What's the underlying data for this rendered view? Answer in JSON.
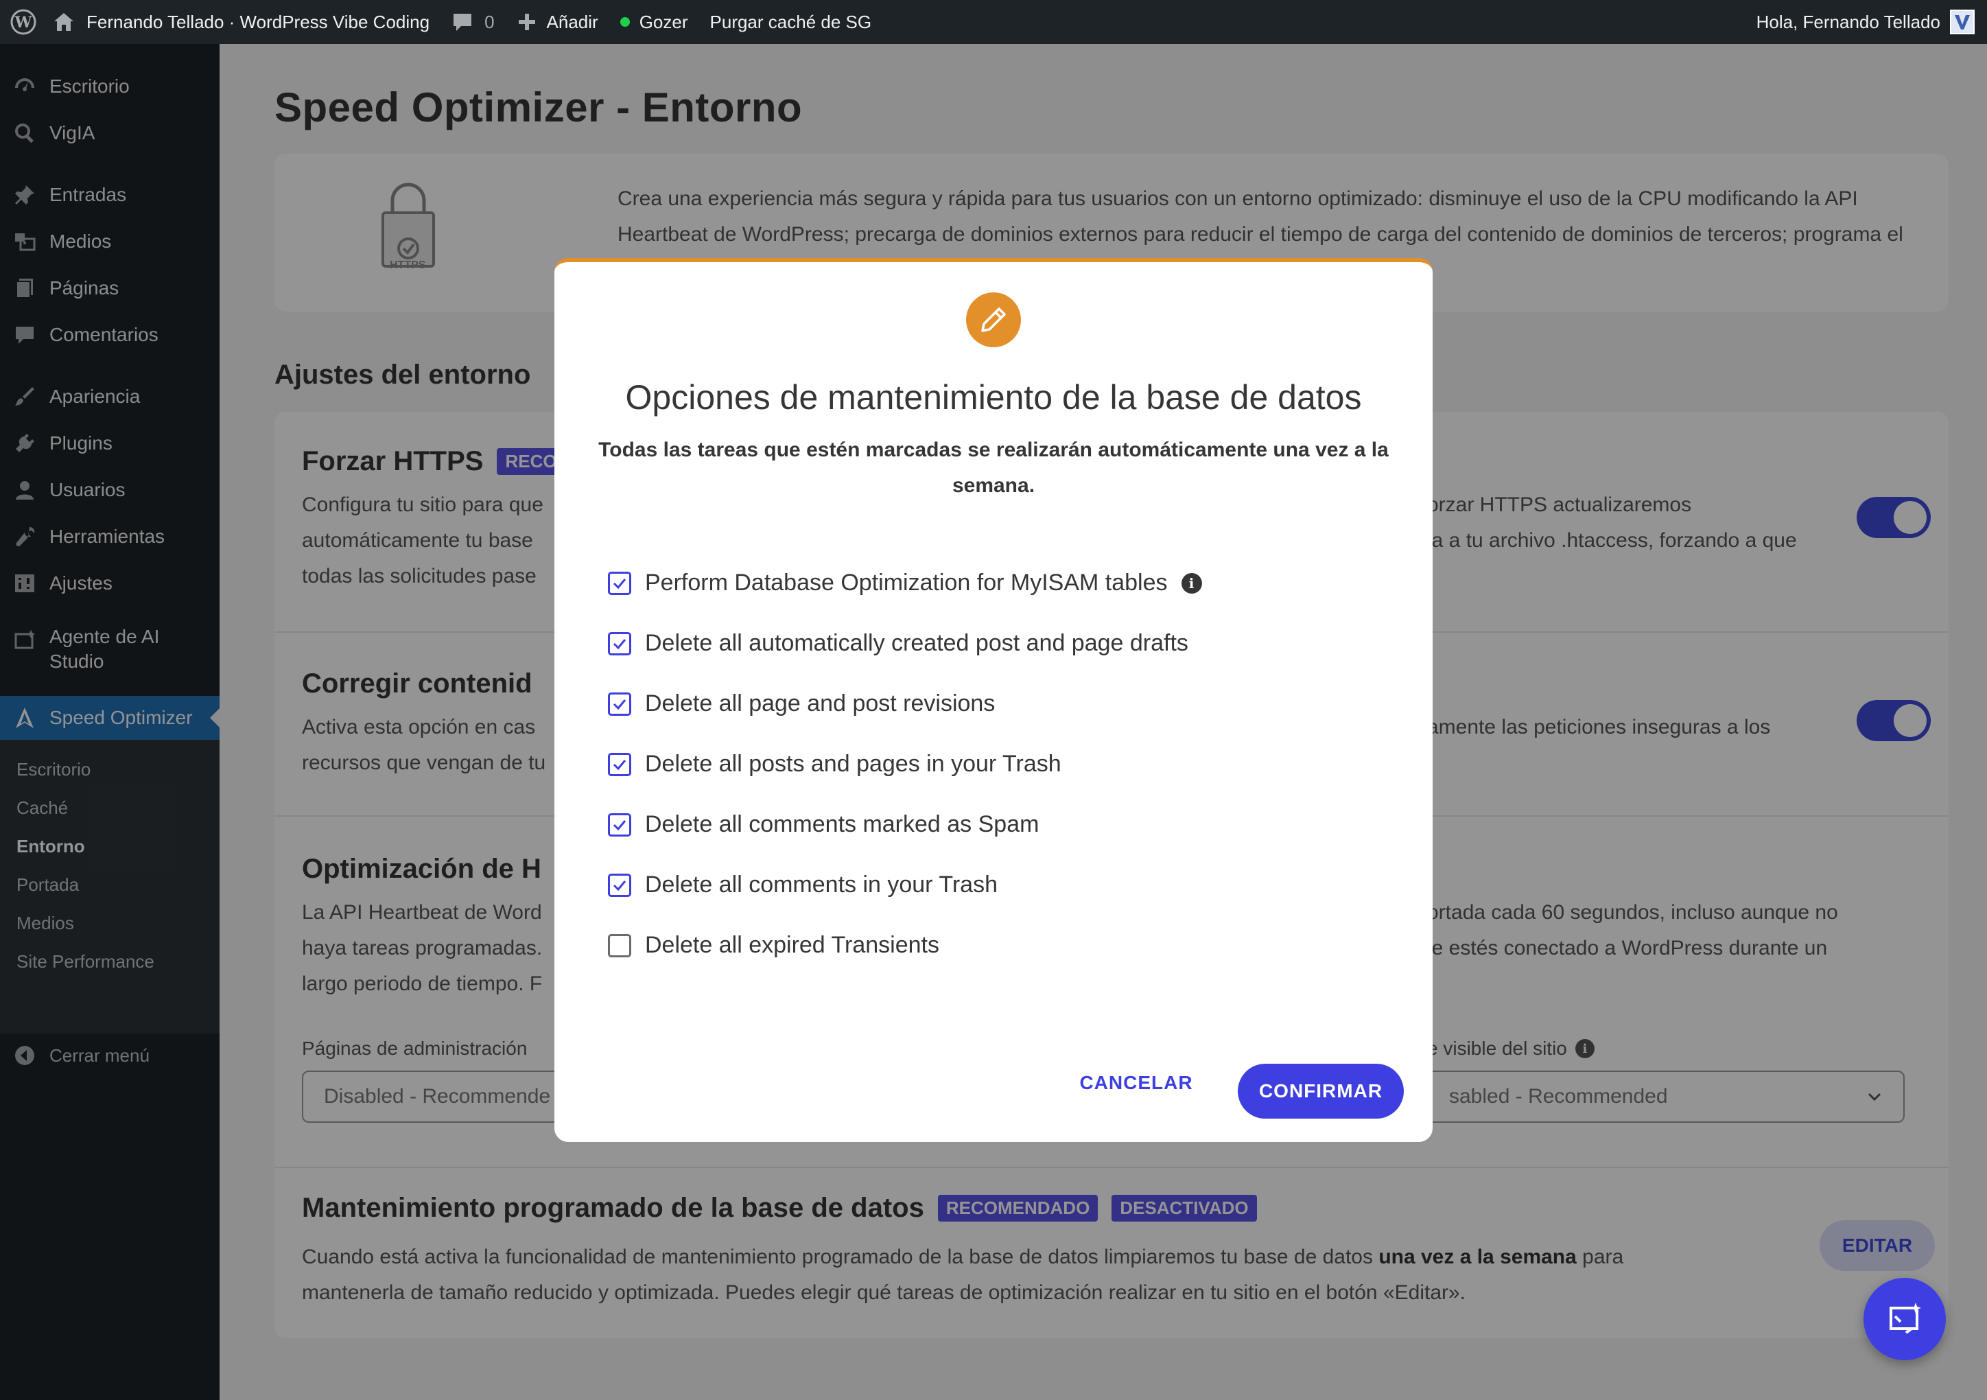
{
  "adminbar": {
    "site_name": "Fernando Tellado · WordPress Vibe Coding",
    "comments_count": "0",
    "add_label": "Añadir",
    "gozer_label": "Gozer",
    "purge_label": "Purgar caché de SG",
    "greeting": "Hola, Fernando Tellado"
  },
  "sidebar": {
    "items": [
      {
        "label": "Escritorio",
        "icon": "dashboard-icon"
      },
      {
        "label": "VigIA",
        "icon": "search-icon"
      },
      {
        "label": "Entradas",
        "icon": "pin-icon"
      },
      {
        "label": "Medios",
        "icon": "media-icon"
      },
      {
        "label": "Páginas",
        "icon": "pages-icon"
      },
      {
        "label": "Comentarios",
        "icon": "comment-icon"
      },
      {
        "label": "Apariencia",
        "icon": "brush-icon"
      },
      {
        "label": "Plugins",
        "icon": "plugin-icon"
      },
      {
        "label": "Usuarios",
        "icon": "user-icon"
      },
      {
        "label": "Herramientas",
        "icon": "wrench-icon"
      },
      {
        "label": "Ajustes",
        "icon": "settings-icon"
      },
      {
        "label": "Agente de AI Studio",
        "icon": "ai-agent-icon"
      },
      {
        "label": "Speed Optimizer",
        "icon": "speed-optimizer-icon"
      }
    ],
    "agent_label_1": "Agente de AI",
    "agent_label_2": "Studio",
    "submenu": [
      "Escritorio",
      "Caché",
      "Entorno",
      "Portada",
      "Medios",
      "Site Performance"
    ],
    "collapse_label": "Cerrar menú"
  },
  "page": {
    "title": "Speed Optimizer - Entorno",
    "https_icon_text": "HTTPS",
    "intro_line1": "Crea una experiencia más segura y rápida para tus usuarios con un entorno optimizado: disminuye el uso de la CPU modificando la API",
    "intro_line2": "Heartbeat de WordPress; precarga de dominios externos para reducir el tiempo de carga del contenido de dominios de terceros; programa el",
    "section_heading": "Ajustes del entorno",
    "https": {
      "title": "Forzar HTTPS",
      "badge": "RECO",
      "left_lines": [
        "Configura tu sitio para que",
        "automáticamente tu base",
        "todas las solicitudes pase"
      ],
      "right_lines": [
        "orzar HTTPS actualizaremos",
        "la a tu archivo .htaccess, forzando a que"
      ]
    },
    "mixed": {
      "title": "Corregir contenid",
      "left_lines": [
        "Activa esta opción en cas",
        "recursos que vengan de tu"
      ],
      "right_line": "amente las peticiones inseguras a los"
    },
    "heartbeat": {
      "title": "Optimización de H",
      "left_lines": [
        "La API Heartbeat de Word",
        "haya tareas programadas.",
        "largo periodo de tiempo. F"
      ],
      "right_lines": [
        "ortada cada 60 segundos, incluso aunque no",
        "ie estés conectado a WordPress durante un"
      ],
      "admin_label": "Páginas de administración",
      "admin_value": "Disabled - Recommende",
      "visible_label": "e visible del sitio",
      "visible_value": "sabled - Recommended"
    },
    "db": {
      "title": "Mantenimiento programado de la base de datos",
      "badge_recommended": "RECOMENDADO",
      "badge_disabled": "DESACTIVADO",
      "line1_a": "Cuando está activa la funcionalidad de mantenimiento programado de la base de datos limpiaremos tu base de datos ",
      "line1_b": "una vez a la semana",
      "line1_c": " para",
      "line2": "mantenerla de tamaño reducido y optimizada. Puedes elegir qué tareas de optimización realizar en tu sitio en el botón «Editar».",
      "edit_label": "EDITAR"
    }
  },
  "modal": {
    "title": "Opciones de mantenimiento de la base de datos",
    "subtitle": "Todas las tareas que estén marcadas se realizarán automáticamente una vez a la semana.",
    "options": [
      {
        "label": "Perform Database Optimization for MyISAM tables",
        "checked": true
      },
      {
        "label": "Delete all automatically created post and page drafts",
        "checked": true
      },
      {
        "label": "Delete all page and post revisions",
        "checked": true
      },
      {
        "label": "Delete all posts and pages in your Trash",
        "checked": true
      },
      {
        "label": "Delete all comments marked as Spam",
        "checked": true
      },
      {
        "label": "Delete all comments in your Trash",
        "checked": true
      },
      {
        "label": "Delete all expired Transients",
        "checked": false
      }
    ],
    "cancel_label": "CANCELAR",
    "confirm_label": "CONFIRMAR"
  },
  "colors": {
    "accent": "#3e3fe0",
    "modal_accent": "#e3902a",
    "admin_bg": "#1d2327",
    "active_menu": "#2271b1"
  }
}
